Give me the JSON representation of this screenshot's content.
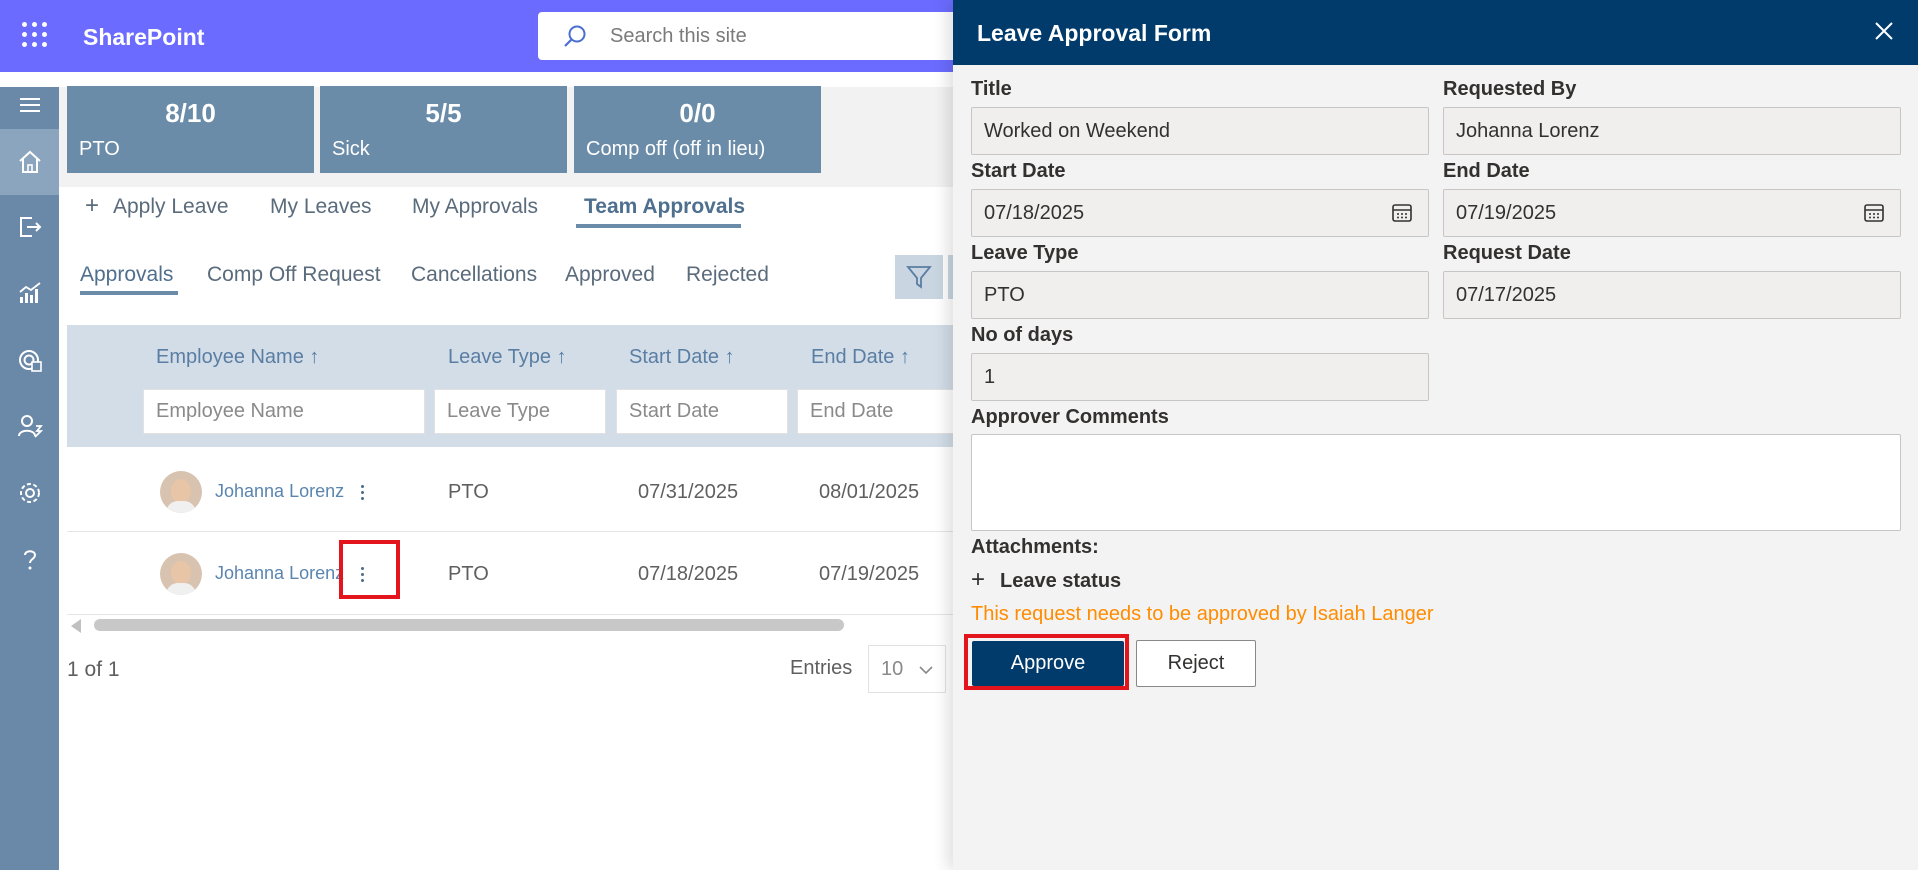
{
  "suite": {
    "app_name": "SharePoint",
    "search_placeholder": "Search this site"
  },
  "rail": {
    "icons": [
      "menu-icon",
      "home-icon",
      "sign-out-icon",
      "analytics-icon",
      "report-icon",
      "user-edit-icon",
      "settings-icon",
      "help-icon"
    ],
    "active": "home-icon"
  },
  "tiles": [
    {
      "value": "8/10",
      "label": "PTO"
    },
    {
      "value": "5/5",
      "label": "Sick"
    },
    {
      "value": "0/0",
      "label": "Comp off (off in lieu)"
    }
  ],
  "main_tabs": {
    "apply_plus": "+",
    "apply": "Apply Leave",
    "my_leaves": "My Leaves",
    "my_approvals": "My Approvals",
    "team_approvals": "Team Approvals",
    "active": "Team Approvals"
  },
  "sub_tabs": {
    "approvals": "Approvals",
    "comp_off": "Comp Off Request",
    "cancellations": "Cancellations",
    "approved": "Approved",
    "rejected": "Rejected",
    "active": "Approvals"
  },
  "table": {
    "columns": [
      {
        "label": "Employee Name ↑",
        "filter_placeholder": "Employee Name"
      },
      {
        "label": "Leave Type ↑",
        "filter_placeholder": "Leave Type"
      },
      {
        "label": "Start Date ↑",
        "filter_placeholder": "Start Date"
      },
      {
        "label": "End Date ↑",
        "filter_placeholder": "End Date"
      }
    ],
    "rows": [
      {
        "employee": "Johanna Lorenz",
        "leave_type": "PTO",
        "start": "07/31/2025",
        "end": "08/01/2025"
      },
      {
        "employee": "Johanna Lorenz",
        "leave_type": "PTO",
        "start": "07/18/2025",
        "end": "07/19/2025"
      }
    ],
    "pager_text": "1 of 1",
    "entries_label": "Entries",
    "entries_value": "10"
  },
  "panel": {
    "title": "Leave Approval Form",
    "fields": {
      "title_label": "Title",
      "title_value": "Worked on Weekend",
      "requested_by_label": "Requested By",
      "requested_by_value": "Johanna Lorenz",
      "start_date_label": "Start Date",
      "start_date_value": "07/18/2025",
      "end_date_label": "End Date",
      "end_date_value": "07/19/2025",
      "leave_type_label": "Leave Type",
      "leave_type_value": "PTO",
      "request_date_label": "Request Date",
      "request_date_value": "07/17/2025",
      "days_label": "No of days",
      "days_value": "1",
      "comments_label": "Approver Comments",
      "comments_value": ""
    },
    "attachments_label": "Attachments:",
    "leave_status_plus": "+",
    "leave_status_label": "Leave status",
    "status_message": "This request needs to be approved by Isaiah Langer",
    "approve_label": "Approve",
    "reject_label": "Reject"
  },
  "colors": {
    "suite_bar": "#6b6cff",
    "rail": "#6a88a7",
    "tile": "#6b8ca8",
    "panel_header": "#003b6b",
    "status_message": "#ff8c00",
    "highlight_box": "#e3141b"
  }
}
